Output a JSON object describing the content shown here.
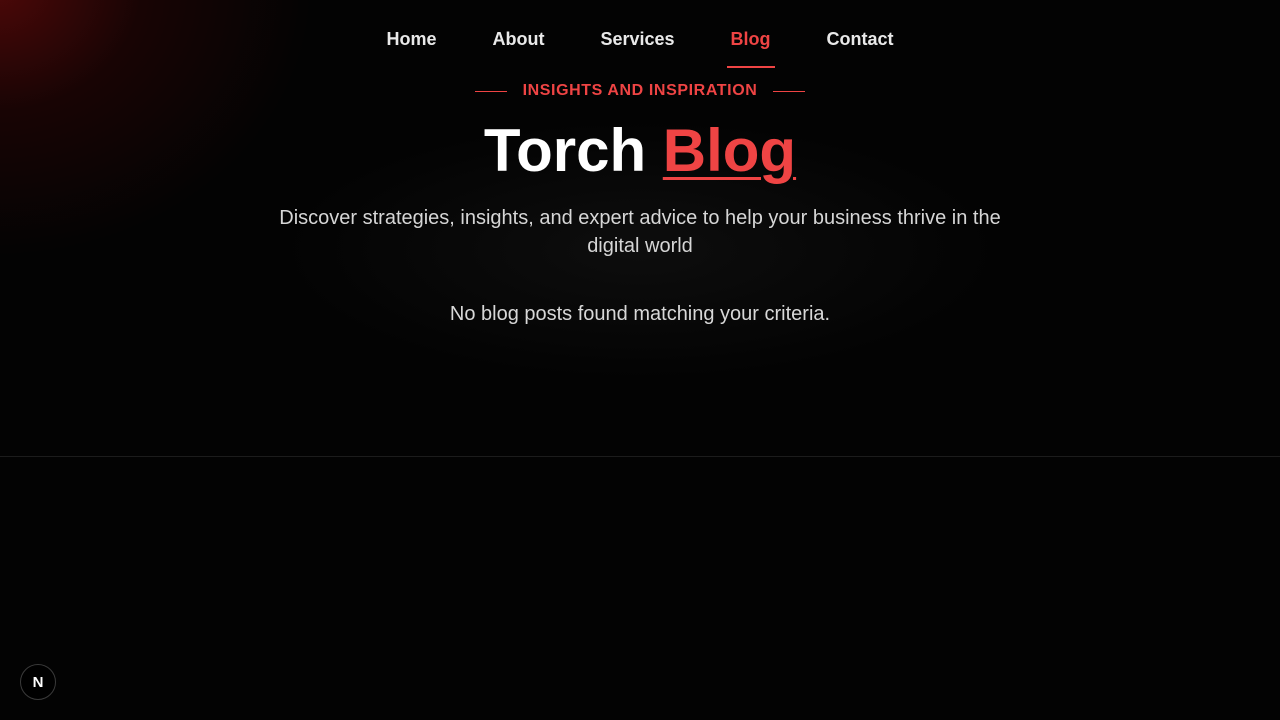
{
  "nav": {
    "items": [
      {
        "label": "Home"
      },
      {
        "label": "About"
      },
      {
        "label": "Services"
      },
      {
        "label": "Blog"
      },
      {
        "label": "Contact"
      }
    ],
    "active": "Blog"
  },
  "hero": {
    "eyebrow": "INSIGHTS AND INSPIRATION",
    "title_main": "Torch",
    "title_accent": "Blog",
    "subtitle": "Discover strategies, insights, and expert advice to help your business thrive in the digital world"
  },
  "content": {
    "empty_message": "No blog posts found matching your criteria."
  },
  "badge": {
    "label": "N",
    "icon": "nextjs-n-icon"
  },
  "colors": {
    "accent": "#ef4444",
    "background": "#030303",
    "text": "#ffffff",
    "muted_text": "#d6d6d6"
  }
}
